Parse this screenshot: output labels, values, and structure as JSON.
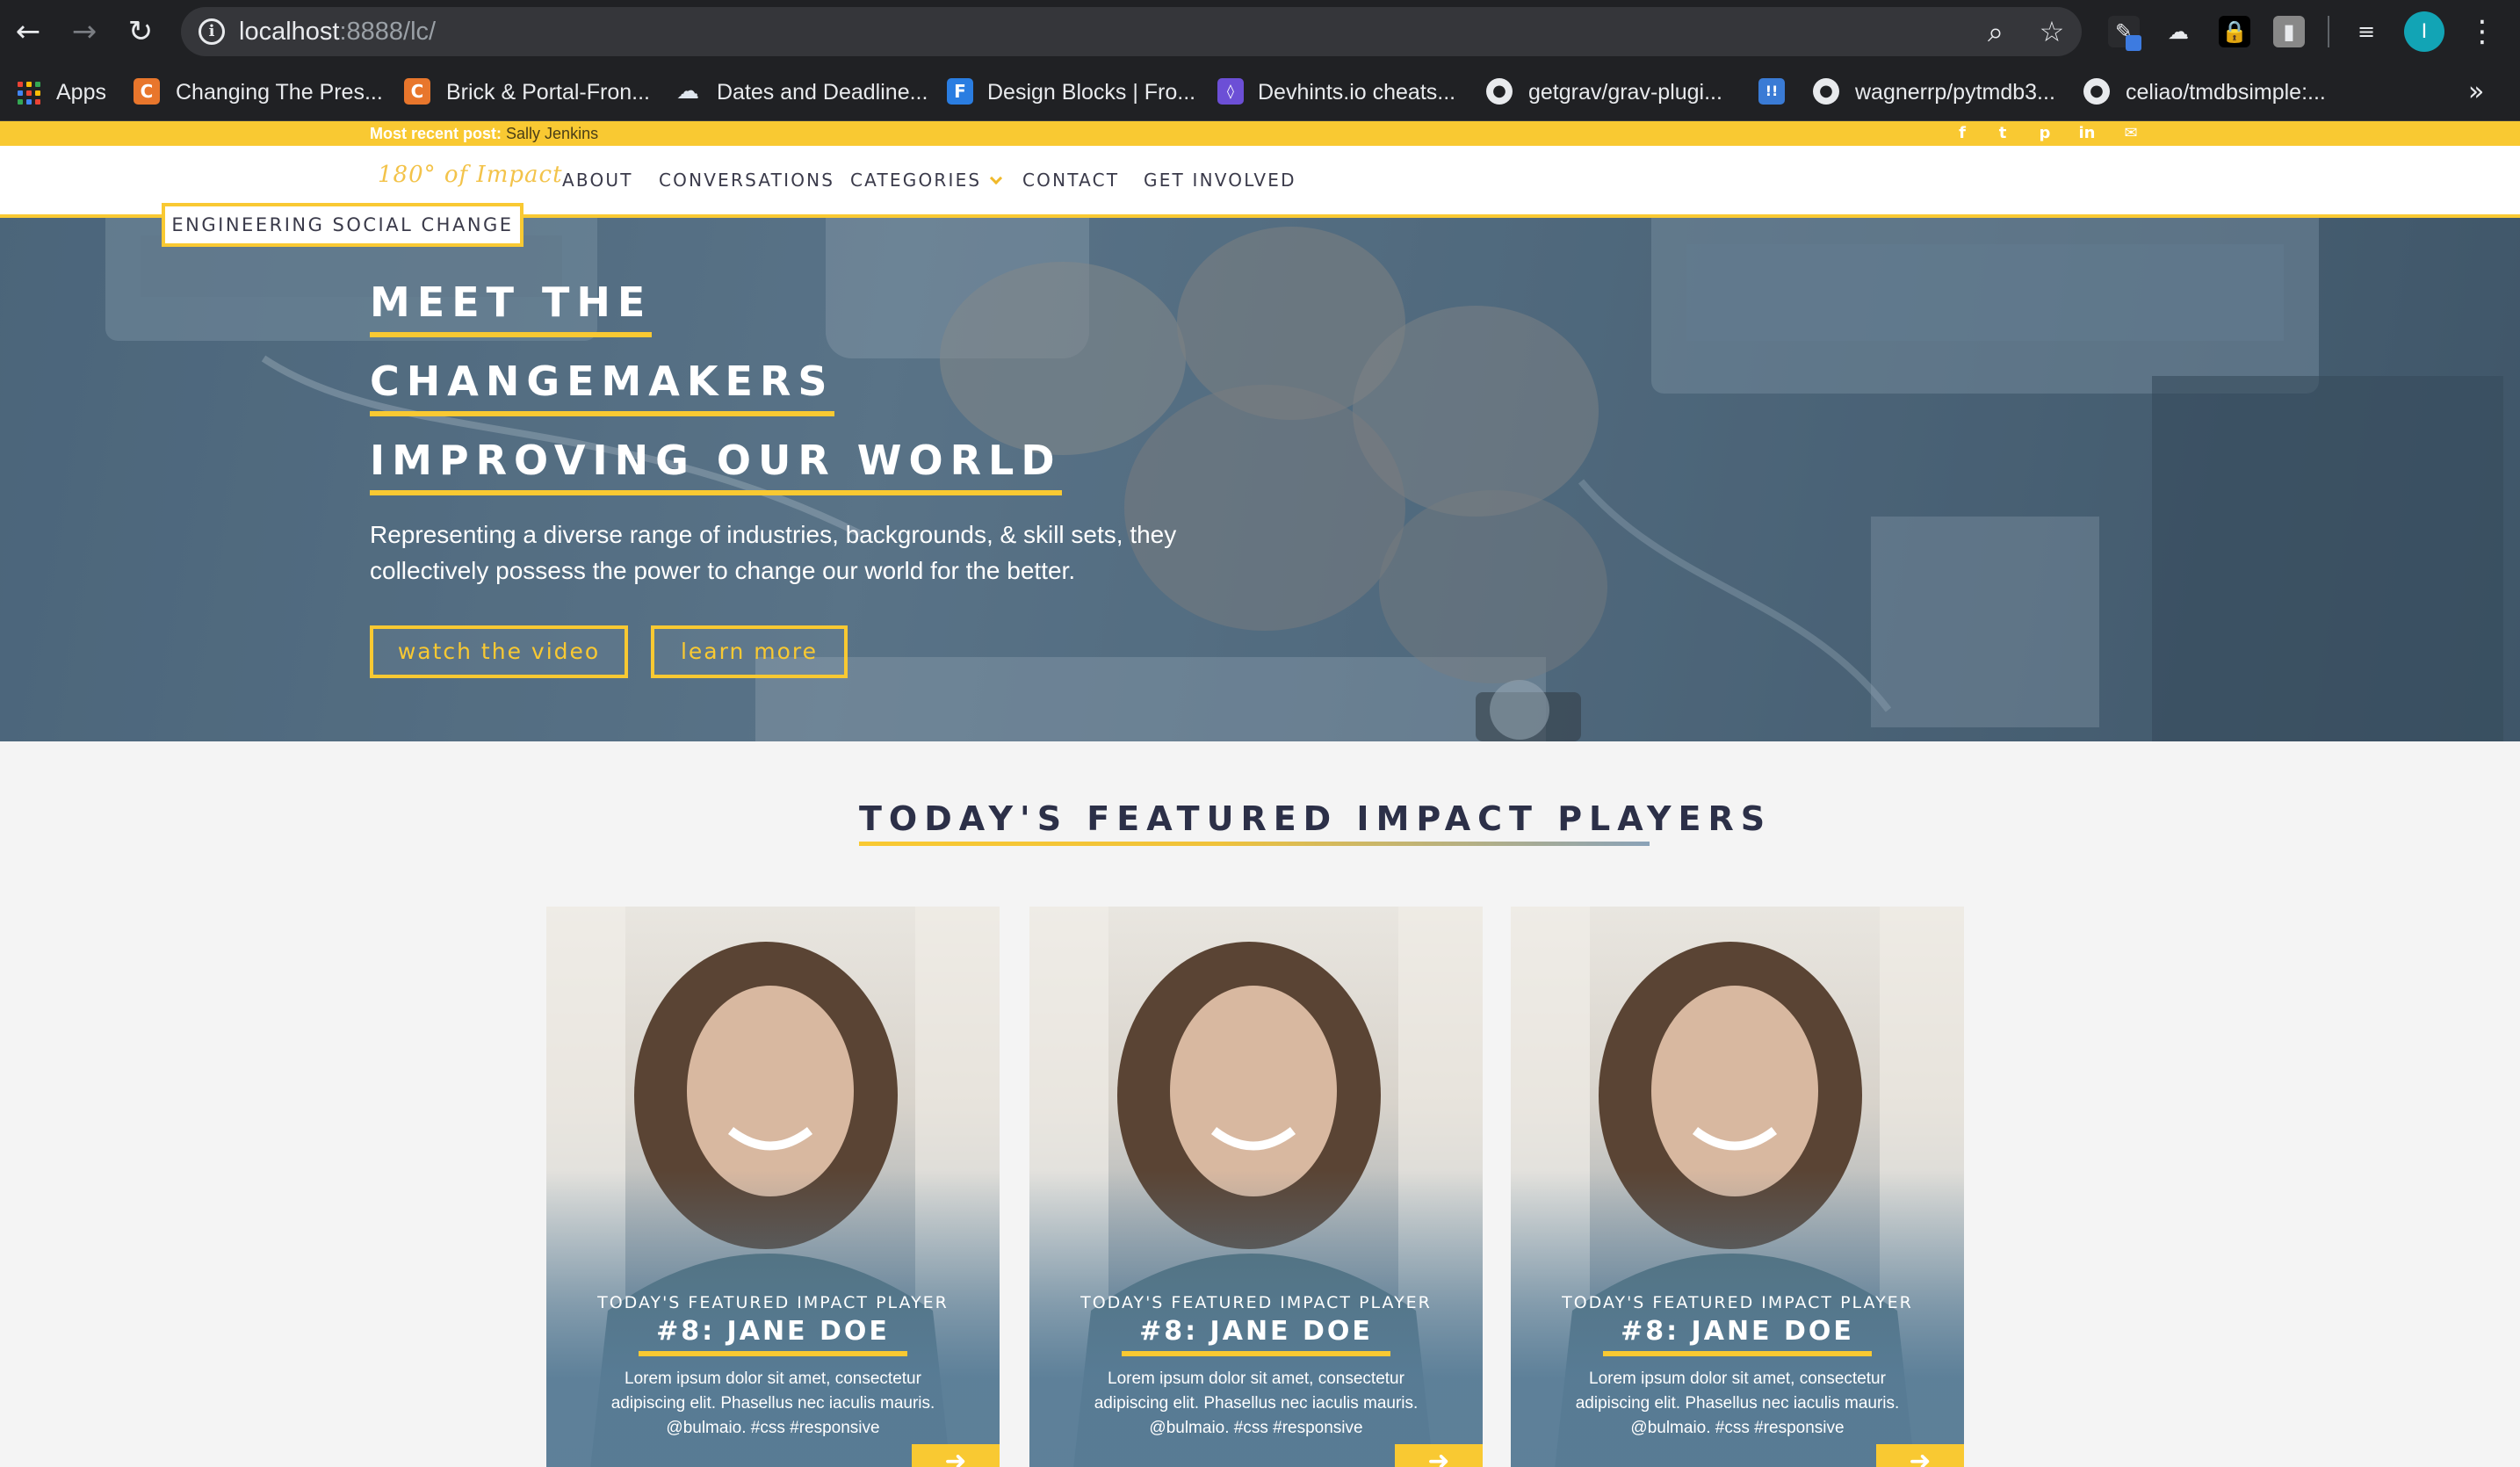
{
  "browser": {
    "url_host": "localhost",
    "url_port_path": ":8888/lc/",
    "profile_initial": "I",
    "bookmarks": [
      {
        "label": "Apps",
        "icon": "apps-grid-icon"
      },
      {
        "label": "Changing The Pres...",
        "icon": "c-icon",
        "color": "#e8762c"
      },
      {
        "label": "Brick & Portal-Fron...",
        "icon": "c-icon",
        "color": "#e8762c"
      },
      {
        "label": "Dates and Deadline...",
        "icon": "cloud-icon",
        "color": "#dfe6ee"
      },
      {
        "label": "Design Blocks | Fro...",
        "icon": "f-icon",
        "color": "#2a7de1"
      },
      {
        "label": "Devhints.io cheats...",
        "icon": "devhints-icon",
        "color": "#6c4fd6"
      },
      {
        "label": "getgrav/grav-plugi...",
        "icon": "github-icon"
      },
      {
        "label": "",
        "icon": "blue-square-icon",
        "color": "#3a7bd5"
      },
      {
        "label": "wagnerrp/pytmdb3...",
        "icon": "github-icon"
      },
      {
        "label": "celiao/tmdbsimple:...",
        "icon": "github-icon"
      }
    ],
    "overflow_label": "»"
  },
  "site": {
    "recent_label": "Most recent post:",
    "recent_value": "Sally Jenkins",
    "logo_text": "180° of Impact",
    "nav": [
      {
        "label": "ABOUT"
      },
      {
        "label": "CONVERSATIONS"
      },
      {
        "label": "CATEGORIES"
      },
      {
        "label": "CONTACT"
      },
      {
        "label": "GET INVOLVED"
      }
    ],
    "tagline": "ENGINEERING SOCIAL CHANGE",
    "social": [
      "f",
      "t",
      "p",
      "in",
      "✉"
    ]
  },
  "hero": {
    "line1": "MEET THE",
    "line2": "CHANGEMAKERS",
    "line3": "IMPROVING OUR WORLD",
    "desc": "Representing a diverse range of industries, backgrounds, & skill sets, they collectively possess the power to change our world for the better.",
    "btn_video": "watch the video",
    "btn_learn": "learn more"
  },
  "featured": {
    "title": "TODAY'S FEATURED IMPACT PLAYERS",
    "cards": [
      {
        "kicker": "TODAY'S FEATURED IMPACT PLAYER",
        "name": "#8: JANE DOE",
        "text": "Lorem ipsum dolor sit amet, consectetur adipiscing elit. Phasellus nec iaculis mauris. @bulmaio. #css #responsive"
      },
      {
        "kicker": "TODAY'S FEATURED IMPACT PLAYER",
        "name": "#8: JANE DOE",
        "text": "Lorem ipsum dolor sit amet, consectetur adipiscing elit. Phasellus nec iaculis mauris. @bulmaio. #css #responsive"
      },
      {
        "kicker": "TODAY'S FEATURED IMPACT PLAYER",
        "name": "#8: JANE DOE",
        "text": "Lorem ipsum dolor sit amet, consectetur adipiscing elit. Phasellus nec iaculis mauris. @bulmaio. #css #responsive"
      }
    ]
  },
  "colors": {
    "accent": "#f9c932",
    "navy": "#2c3048",
    "card_blue": "#587c96"
  }
}
